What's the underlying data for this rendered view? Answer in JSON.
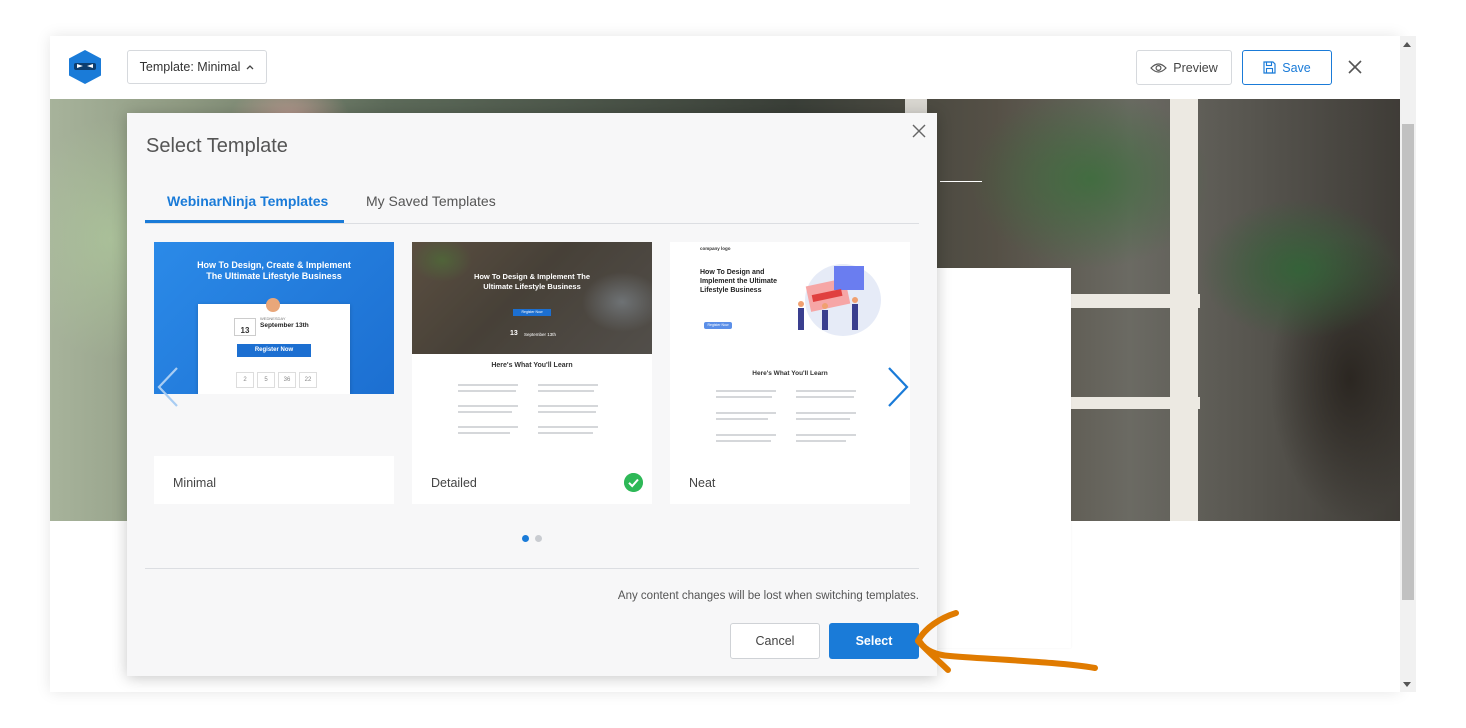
{
  "toolbar": {
    "template_label": "Template: Minimal",
    "template_caret": "^",
    "preview_label": "Preview",
    "save_label": "Save"
  },
  "modal": {
    "title": "Select Template",
    "tabs": [
      {
        "label": "WebinarNinja Templates",
        "active": true
      },
      {
        "label": "My Saved Templates",
        "active": false
      }
    ],
    "templates": [
      {
        "name": "Minimal",
        "selected": false,
        "preview": {
          "headline": "How To  Design, Create & Implement The Ultimate Lifestyle Business",
          "day_num": "13",
          "weekday": "WEDNESDAY",
          "date": "September 13th",
          "register": "Register Now",
          "countdown": [
            "2",
            "5",
            "36",
            "22"
          ]
        }
      },
      {
        "name": "Detailed",
        "selected": true,
        "preview": {
          "headline": "How To Design & Implement The Ultimate Lifestyle Business",
          "register": "Register Now",
          "day_num": "13",
          "date": "September 13th",
          "section": "Here's What You'll Learn"
        }
      },
      {
        "name": "Neat",
        "selected": false,
        "preview": {
          "logo": "company logo",
          "headline": "How To  Design and Implement the Ultimate Lifestyle Business",
          "register": "Register Now",
          "section": "Here's What You'll Learn"
        }
      }
    ],
    "page_dots": 2,
    "active_dot": 0,
    "warning": "Any content changes will be lost when switching templates.",
    "cancel_label": "Cancel",
    "select_label": "Select"
  },
  "colors": {
    "accent": "#1a7bd8",
    "success": "#2eb857",
    "annotation_arrow": "#e07b00"
  },
  "icons": [
    "ninja-logo-icon",
    "eye-icon",
    "floppy-disk-icon",
    "close-icon",
    "chevron-left-icon",
    "chevron-right-icon",
    "check-circle-icon"
  ]
}
